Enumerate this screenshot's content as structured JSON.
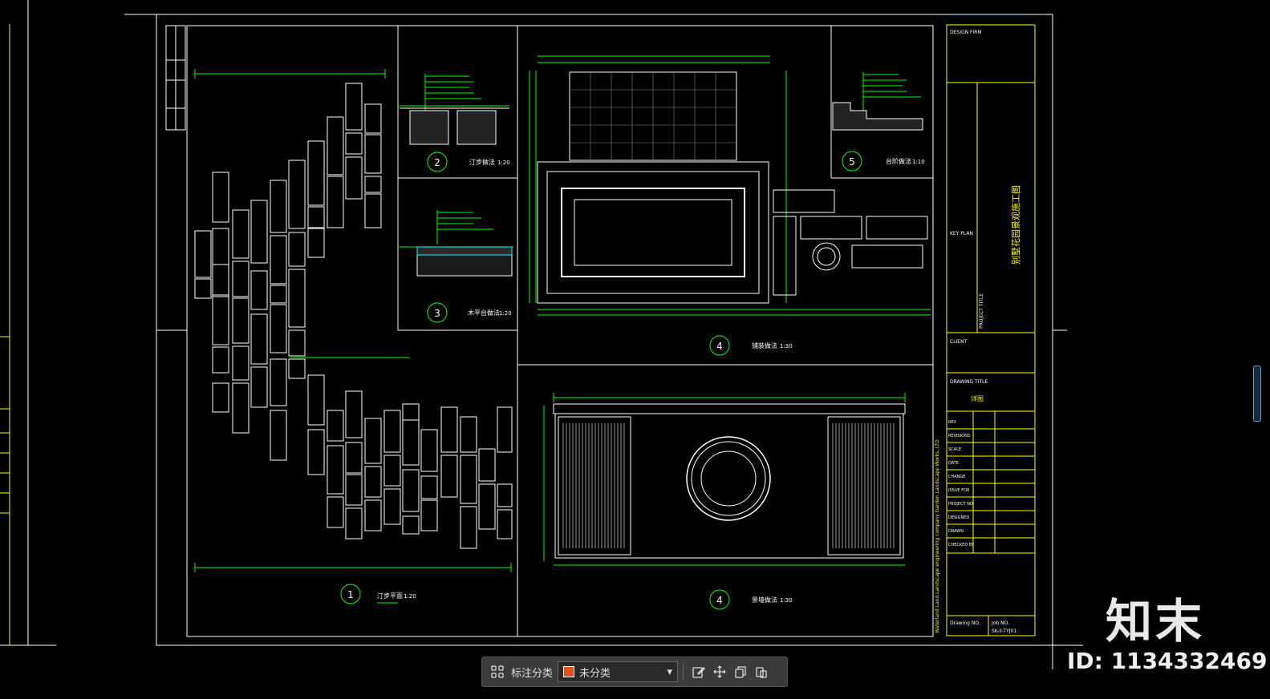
{
  "colors": {
    "background": "#000000",
    "line_white": "#ffffff",
    "line_green": "#00ff00",
    "line_yellow": "#ffff00",
    "line_red": "#ff0000",
    "swatch": "#e0521a"
  },
  "views": {
    "v1": {
      "num": "1",
      "title": "汀步平面",
      "scale": "1:20"
    },
    "v2": {
      "num": "2",
      "title": "汀步做法",
      "scale": "1:20"
    },
    "v3": {
      "num": "3",
      "title": "木平台做法",
      "scale": "1:20"
    },
    "v4a": {
      "num": "4",
      "title": "铺装做法",
      "scale": "1:30"
    },
    "v4b": {
      "num": "4",
      "title": "景墙做法",
      "scale": "1:30"
    },
    "v5": {
      "num": "5",
      "title": "台阶做法",
      "scale": "1:10"
    }
  },
  "title_block": {
    "design_firm": "DESIGN FIRM",
    "key_plan": "KEY PLAN",
    "project_title": "PROJECT TITLE",
    "project_name": "别墅花园景观施工图",
    "client": "CLIENT",
    "drawing_title_label": "DRAWING TITLE",
    "drawing_title": "详图",
    "rows": [
      "REV",
      "REVISIONS",
      "SCALE",
      "DATE",
      "CHANGE",
      "ISSUE FOR",
      "PROJECT NO.",
      "DESIGNED",
      "DRAWN",
      "CHECKED BY"
    ],
    "company": "Waterland Land Landscape engineering company Garden Landscape Works, LTD",
    "drawing_no_label": "Drawing NO.",
    "job_no_label": "Job NO.",
    "job_no": "SK-II-TYJ01"
  },
  "toolbar": {
    "label": "标注分类",
    "selected": "未分类"
  },
  "watermark": {
    "logo": "知末",
    "id": "ID: 1134332469"
  }
}
